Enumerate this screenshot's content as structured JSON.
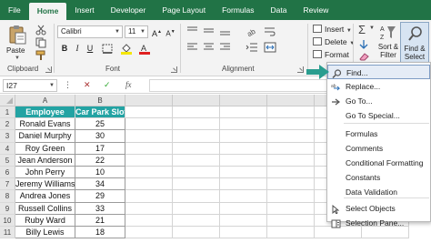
{
  "ribbon_tabs": [
    "File",
    "Home",
    "Insert",
    "Developer",
    "Page Layout",
    "Formulas",
    "Data",
    "Review"
  ],
  "active_tab": "Home",
  "clipboard": {
    "paste_label": "Paste",
    "group_label": "Clipboard"
  },
  "font": {
    "name": "Calibri",
    "size": "11",
    "group_label": "Font"
  },
  "alignment": {
    "group_label": "Alignment"
  },
  "cells": {
    "insert_label": "Insert",
    "delete_label": "Delete",
    "format_label": "Format"
  },
  "editing": {
    "sort_filter_label": "Sort &\nFilter",
    "find_select_label": "Find &\nSelect"
  },
  "formula_bar": {
    "name_box": "I27",
    "fx": "fx"
  },
  "grid": {
    "columns": [
      "A",
      "B"
    ],
    "header": [
      "Employee",
      "Car Park Slot"
    ],
    "rows": [
      {
        "num": "1"
      },
      {
        "num": "2",
        "employee": "Ronald Evans",
        "slot": "25"
      },
      {
        "num": "3",
        "employee": "Daniel Murphy",
        "slot": "30"
      },
      {
        "num": "4",
        "employee": "Roy Green",
        "slot": "17"
      },
      {
        "num": "5",
        "employee": "Jean Anderson",
        "slot": "22"
      },
      {
        "num": "6",
        "employee": "John Perry",
        "slot": "10"
      },
      {
        "num": "7",
        "employee": "Jeremy Williams",
        "slot": "34"
      },
      {
        "num": "8",
        "employee": "Andrea Jones",
        "slot": "29"
      },
      {
        "num": "9",
        "employee": "Russell Collins",
        "slot": "33"
      },
      {
        "num": "10",
        "employee": "Ruby Ward",
        "slot": "21"
      },
      {
        "num": "11",
        "employee": "Billy Lewis",
        "slot": "18"
      }
    ]
  },
  "find_menu": {
    "items": [
      {
        "label": "Find...",
        "icon": "search-icon",
        "selected": true
      },
      {
        "label": "Replace...",
        "icon": "replace-icon"
      },
      {
        "label": "Go To...",
        "icon": "goto-arrow-icon"
      },
      {
        "label": "Go To Special...",
        "icon": ""
      },
      {
        "label": "Formulas",
        "icon": ""
      },
      {
        "label": "Comments",
        "icon": ""
      },
      {
        "label": "Conditional Formatting",
        "icon": ""
      },
      {
        "label": "Constants",
        "icon": ""
      },
      {
        "label": "Data Validation",
        "icon": ""
      },
      {
        "label": "Select Objects",
        "icon": "select-objects-icon"
      },
      {
        "label": "Selection Pane...",
        "icon": "selection-pane-icon"
      }
    ]
  },
  "colors": {
    "ribbon_green": "#217346",
    "table_header_teal": "#23a3a3",
    "pointer_teal": "#2a9d8f"
  }
}
